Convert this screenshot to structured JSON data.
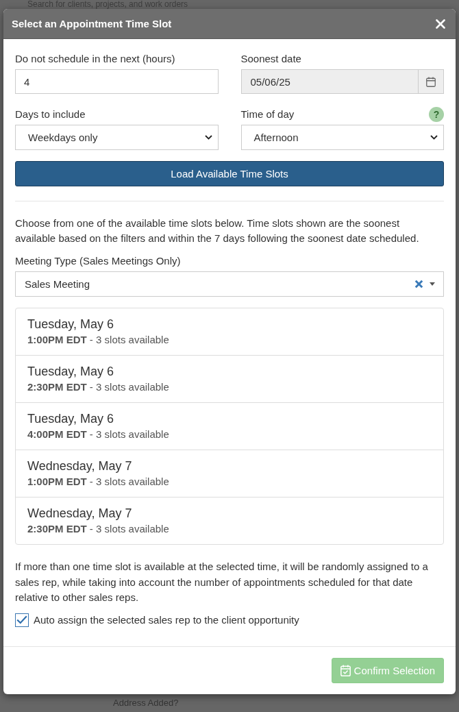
{
  "background_page": {
    "search_text": "Search for clients, projects, and work orders",
    "label": "Address Added?"
  },
  "dialog": {
    "title": "Select an Appointment Time Slot",
    "fields": [
      {
        "kind": "text",
        "label": "Do not schedule in the next (hours)",
        "value": "4",
        "disabled": false
      },
      {
        "kind": "date",
        "label": "Soonest date",
        "value": "05/06/25",
        "disabled": true
      },
      {
        "kind": "select",
        "label": "Days to include",
        "value": "Weekdays only",
        "disabled": false
      },
      {
        "kind": "select",
        "label": "Time of day",
        "value": "Afternoon",
        "disabled": false,
        "help": "?"
      }
    ],
    "load_button": "Load Available Time Slots",
    "intro": "Choose from one of the available time slots below. Time slots shown are the soonest available based on the filters and within the 7 days following the soonest date scheduled.",
    "meeting_type": {
      "label": "Meeting Type (Sales Meetings Only)",
      "value": "Sales Meeting"
    },
    "slots": [
      {
        "date": "Tuesday, May 6",
        "time": "**1:00PM EDT** - 3 slots available",
        "selected": false
      },
      {
        "date": "Tuesday, May 6",
        "time": "**2:30PM EDT** - 3 slots available",
        "selected": false
      },
      {
        "date": "Tuesday, May 6",
        "time": "**4:00PM EDT** - 3 slots available",
        "selected": false
      },
      {
        "date": "Wednesday, May 7",
        "time": "**1:00PM EDT** - 3 slots available",
        "selected": false
      },
      {
        "date": "Wednesday, May 7",
        "time": "**2:30PM EDT** - 3 slots available",
        "selected": false
      }
    ],
    "note": "If more than one time slot is available at the selected time, it will be randomly assigned to a sales rep, while taking into account the number of appointments scheduled for that date relative to other sales reps.",
    "auto_assign": {
      "label": "Auto assign the selected sales rep to the client opportunity",
      "checked": true
    },
    "confirm_button": {
      "label": "Confirm Selection",
      "disabled": true
    }
  }
}
